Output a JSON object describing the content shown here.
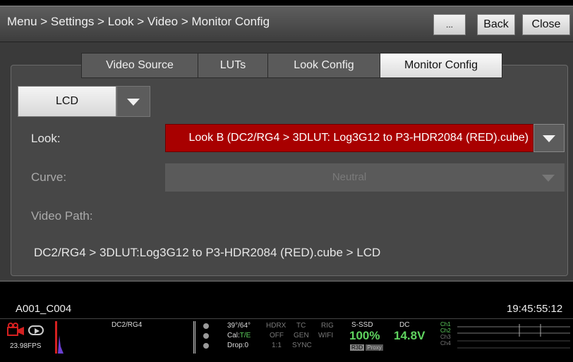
{
  "titlebar": {
    "breadcrumb": "Menu > Settings > Look > Video > Monitor Config",
    "more_label": "...",
    "back_label": "Back",
    "close_label": "Close"
  },
  "tabs": [
    {
      "label": "Video Source"
    },
    {
      "label": "LUTs"
    },
    {
      "label": "Look Config"
    },
    {
      "label": "Monitor Config"
    }
  ],
  "monitor_select": {
    "value": "LCD"
  },
  "form": {
    "look_label": "Look:",
    "look_value": "Look B (DC2/RG4 > 3DLUT: Log3G12 to P3-HDR2084 (RED).cube)",
    "curve_label": "Curve:",
    "curve_value": "Neutral",
    "video_path_label": "Video Path:",
    "video_path_value": "DC2/RG4 > 3DLUT:Log3G12 to P3-HDR2084 (RED).cube > LCD"
  },
  "status": {
    "clip_name": "A001_C004",
    "timecode": "19:45:55:12",
    "fps": "23.98FPS",
    "look_name": "DC2/RG4",
    "temp": "39°/64°",
    "cal_label": "Cal:",
    "cal_value": "T/E",
    "drop": "Drop:0",
    "hdrx": "HDRX",
    "hdrx_val": "OFF",
    "hdrx_ratio": "1:1",
    "tc": "TC",
    "gen": "GEN",
    "sync": "SYNC",
    "rig": "RIG",
    "wifi": "WIFI",
    "media_label": "S-SSD",
    "media_value": "100%",
    "r3d": "R3D",
    "proxy": "Proxy",
    "dc_label": "DC",
    "dc_value": "14.8V",
    "channels": [
      "Ch1",
      "Ch2",
      "Ch3",
      "Ch4"
    ],
    "colors": {
      "accent_green": "#5fd35f",
      "rec_red": "#d42020",
      "look_red": "#a80000"
    }
  }
}
